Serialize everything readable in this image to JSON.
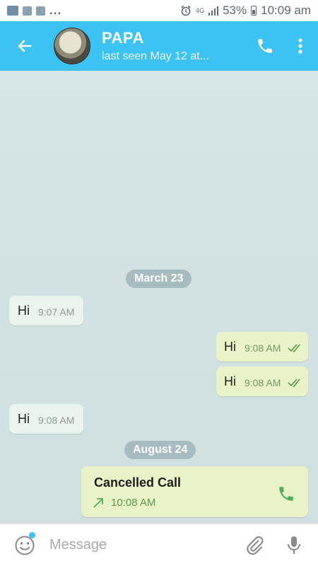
{
  "status_bar": {
    "left_dots": "...",
    "network": "4G",
    "battery": "53%",
    "time": "10:09 am"
  },
  "header": {
    "contact_name": "PAPA",
    "last_seen": "last seen May 12 at..."
  },
  "chat": {
    "date_1": "March 23",
    "date_2": "August 24",
    "messages": [
      {
        "direction": "in",
        "text": "Hi",
        "time": "9:07 AM"
      },
      {
        "direction": "out",
        "text": "Hi",
        "time": "9:08 AM"
      },
      {
        "direction": "out",
        "text": "Hi",
        "time": "9:08 AM"
      },
      {
        "direction": "in",
        "text": "Hi",
        "time": "9:08 AM"
      }
    ],
    "call": {
      "title": "Cancelled Call",
      "time": "10:08 AM"
    }
  },
  "input": {
    "placeholder": "Message"
  },
  "colors": {
    "header": "#3cc3f4",
    "incoming_bubble": "#e8f4ec",
    "outgoing_bubble": "#eaf2c8",
    "date_pill": "#a7bcc0",
    "call_green": "#4fb05a"
  }
}
